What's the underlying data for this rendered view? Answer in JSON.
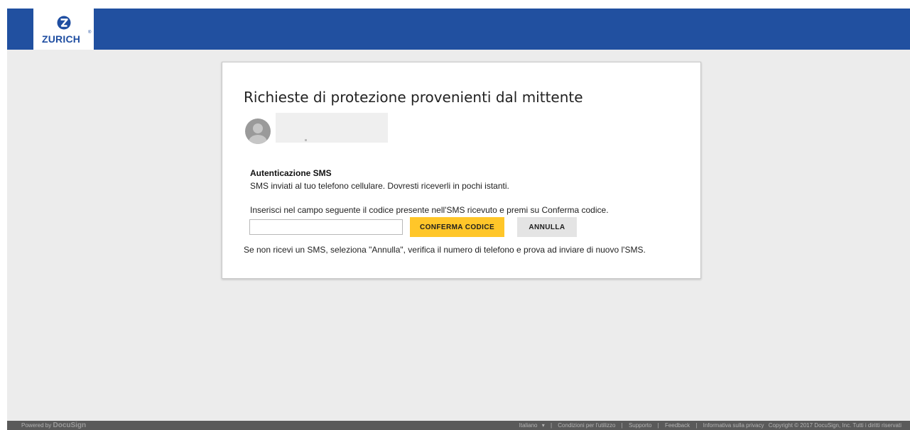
{
  "brand": {
    "logo_text": "ZURICH",
    "registered_mark": "®",
    "color": "#2150a0",
    "logo_color": "#1f4ea1"
  },
  "card": {
    "title": "Richieste di protezione provenienti dal mittente",
    "sms_title": "Autenticazione SMS",
    "sms_desc": "SMS inviati al tuo telefono cellulare. Dovresti riceverli in pochi istanti.",
    "instructions": "Inserisci nel campo seguente il codice presente nell'SMS ricevuto e premi su Conferma codice.",
    "code_input": {
      "value": "",
      "placeholder": ""
    },
    "confirm_label": "CONFERMA CODICE",
    "cancel_label": "ANNULLA",
    "note": "Se non ricevi un SMS, seleziona \"Annulla\", verifica il numero di telefono e prova ad inviare di nuovo l'SMS."
  },
  "footer": {
    "powered_by": "Powered by",
    "powered_brand": "DocuSign",
    "language": "Italiano",
    "language_icon": "chevron-down-icon",
    "links": [
      "Condizioni per l'utilizzo",
      "Supporto",
      "Feedback",
      "Informativa sulla privacy"
    ],
    "copyright": "Copyright © 2017 DocuSign, Inc. Tutti i diritti riservati"
  },
  "colors": {
    "accent_button": "#ffc629",
    "secondary_button": "#e4e4e4",
    "page_background": "#ececec"
  }
}
